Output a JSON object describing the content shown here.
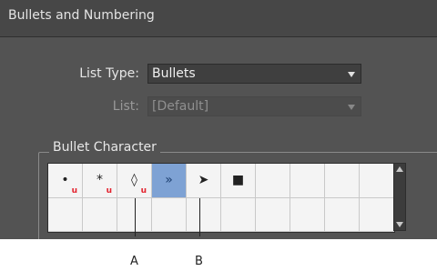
{
  "dialog": {
    "title": "Bullets and Numbering",
    "list_type": {
      "label": "List Type:",
      "value": "Bullets"
    },
    "list": {
      "label": "List:",
      "value": "[Default]"
    }
  },
  "bullet_character": {
    "legend": "Bullet Character",
    "cells": [
      {
        "glyph": "•",
        "unicode_badge": "u",
        "selected": false
      },
      {
        "glyph": "*",
        "unicode_badge": "u",
        "selected": false
      },
      {
        "glyph": "◊",
        "unicode_badge": "u",
        "selected": false
      },
      {
        "glyph": "»",
        "unicode_badge": "",
        "selected": true
      },
      {
        "glyph": "➤",
        "unicode_badge": "",
        "selected": false
      },
      {
        "glyph": "■",
        "unicode_badge": "",
        "selected": false
      }
    ],
    "columns": 10,
    "rows": 2
  },
  "callouts": [
    {
      "label": "A"
    },
    {
      "label": "B"
    }
  ],
  "colors": {
    "dialog_bg": "#535353",
    "selected_cell": "#7ea2d4",
    "unicode_badge": "#e3232e"
  }
}
